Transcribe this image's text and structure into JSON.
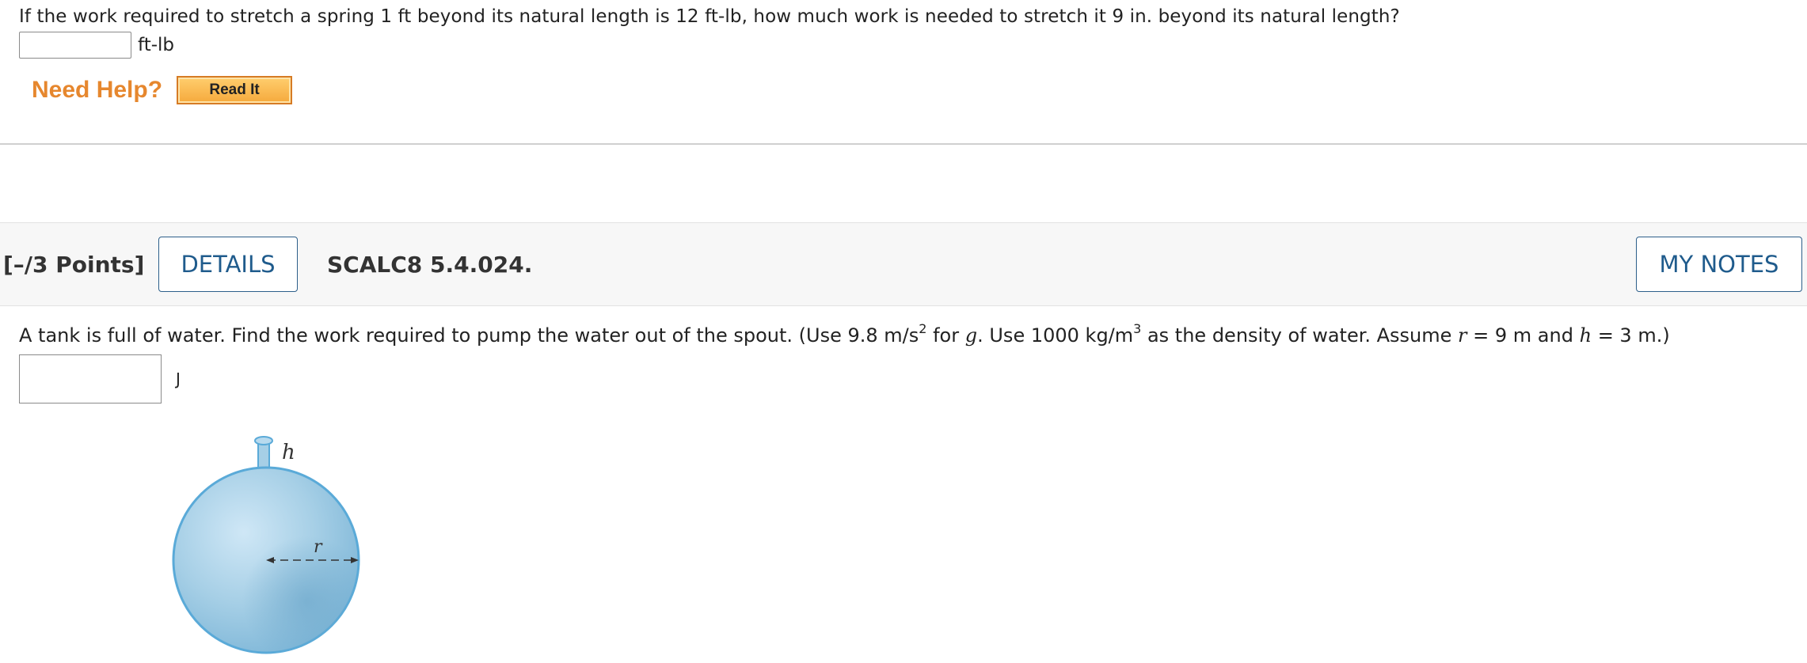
{
  "question1": {
    "text": "If the work required to stretch a spring 1 ft beyond its natural length is 12 ft-lb, how much work is needed to stretch it 9 in. beyond its natural length?",
    "answer_value": "",
    "unit": "ft-lb"
  },
  "help": {
    "label": "Need Help?",
    "read_it_label": "Read It"
  },
  "question2": {
    "points": "[–/3 Points]",
    "details_label": "DETAILS",
    "problem_code": "SCALC8 5.4.024.",
    "my_notes_label": "MY NOTES",
    "text_part1": "A tank is full of water. Find the work required to pump the water out of the spout. (Use 9.8 m/s",
    "sup1": "2",
    "text_part2": " for ",
    "g_symbol": "g",
    "text_part3": ". Use 1000 kg/m",
    "sup2": "3",
    "text_part4": " as the density of water. Assume ",
    "r_symbol": "r",
    "text_part5": " = 9 m and ",
    "h_symbol": "h",
    "text_part6": " = 3 m.)",
    "answer_value": "",
    "unit": "J"
  },
  "figure": {
    "h_label": "h",
    "r_label": "r",
    "colors": {
      "water": "#9cc7e0",
      "outline": "#5aaad8",
      "highlight": "#c9e3f3"
    }
  }
}
